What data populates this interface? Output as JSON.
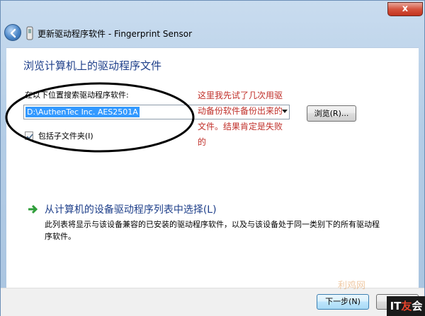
{
  "window": {
    "title": "更新驱动程序软件 - Fingerprint Sensor",
    "close_label": "x"
  },
  "content": {
    "heading": "浏览计算机上的驱动程序文件",
    "search_label": "在以下位置搜索驱动程序软件:",
    "path_value": "D:\\AuthenTec Inc. AES2501A",
    "browse_label": "浏览(R)...",
    "include_subfolders_label": "包括子文件夹(I)",
    "include_subfolders_checked": true
  },
  "annotation": {
    "text": "这里我先试了几次用驱动备份软件备份出来的文件。结果肯定是失败的",
    "color": "#c0302a"
  },
  "pick_option": {
    "title": "从计算机的设备驱动程序列表中选择(L)",
    "description": "此列表将显示与该设备兼容的已安装的驱动程序软件，以及与该设备处于同一类别下的所有驱动程序软件。"
  },
  "footer": {
    "next_label": "下一步(N)",
    "cancel_label": "取消"
  },
  "overlay": {
    "watermark": "利鸡网",
    "logo_left": "IT",
    "logo_mid": "友",
    "logo_right": "会"
  },
  "icons": {
    "back": "back-arrow-icon",
    "app": "device-icon",
    "pick_arrow": "green-arrow-icon",
    "checkmark": "checkmark-icon"
  },
  "colors": {
    "heading": "#1e3f8a",
    "selection": "#3399ff",
    "close": "#c2331f"
  }
}
